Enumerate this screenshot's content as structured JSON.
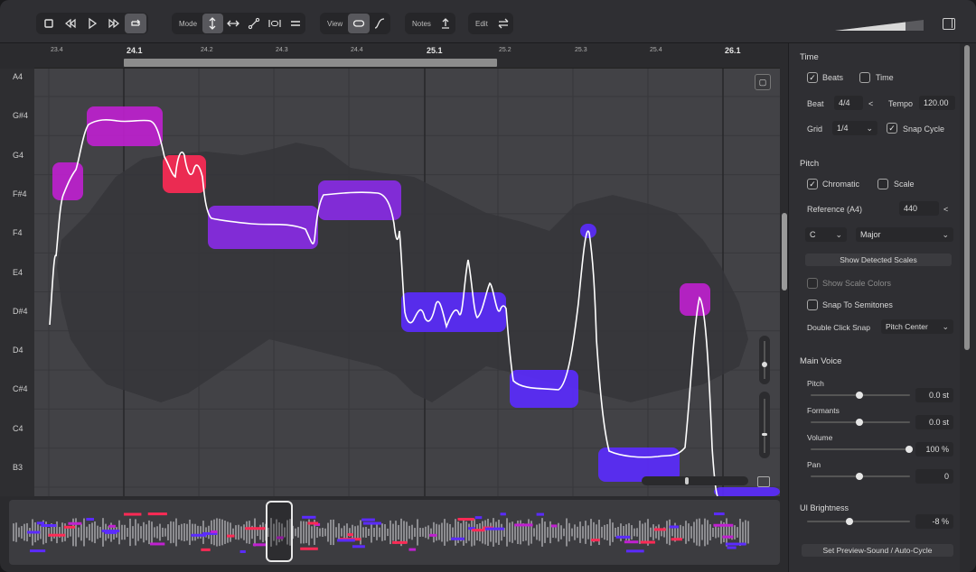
{
  "toolbar": {
    "mode_label": "Mode",
    "view_label": "View",
    "notes_label": "Notes",
    "edit_label": "Edit"
  },
  "ruler": {
    "ticks": [
      {
        "label": "23.4",
        "major": false
      },
      {
        "label": "24.1",
        "major": true
      },
      {
        "label": "24.2",
        "major": false
      },
      {
        "label": "24.3",
        "major": false
      },
      {
        "label": "24.4",
        "major": false
      },
      {
        "label": "25.1",
        "major": true
      },
      {
        "label": "25.2",
        "major": false
      },
      {
        "label": "25.3",
        "major": false
      },
      {
        "label": "25.4",
        "major": false
      },
      {
        "label": "26.1",
        "major": true
      }
    ]
  },
  "keys": [
    "A4",
    "G#4",
    "G4",
    "F#4",
    "F4",
    "E4",
    "D#4",
    "D4",
    "C#4",
    "C4",
    "B3"
  ],
  "panel": {
    "time": {
      "title": "Time",
      "beats_label": "Beats",
      "time_label": "Time",
      "beat_label": "Beat",
      "beat_value": "4/4",
      "beat_arrow": "<",
      "tempo_label": "Tempo",
      "tempo_value": "120.00",
      "grid_label": "Grid",
      "grid_value": "1/4",
      "snap_cycle_label": "Snap Cycle"
    },
    "pitch": {
      "title": "Pitch",
      "chromatic_label": "Chromatic",
      "scale_label": "Scale",
      "reference_label": "Reference (A4)",
      "reference_value": "440",
      "reference_arrow": "<",
      "key_value": "C",
      "scale_value": "Major",
      "show_detected_label": "Show Detected Scales",
      "show_scale_colors_label": "Show Scale Colors",
      "snap_semitones_label": "Snap To Semitones",
      "double_click_label": "Double Click Snap",
      "double_click_value": "Pitch Center"
    },
    "main_voice": {
      "title": "Main Voice",
      "pitch_label": "Pitch",
      "pitch_value": "0.0 st",
      "formants_label": "Formants",
      "formants_value": "0.0 st",
      "volume_label": "Volume",
      "volume_value": "100 %",
      "pan_label": "Pan",
      "pan_value": "0"
    },
    "ui_brightness": {
      "title": "UI Brightness",
      "value": "-8 %"
    },
    "preview_button": "Set Preview-Sound / Auto-Cycle"
  },
  "colors": {
    "note_purple": "#8a2be8",
    "note_blue": "#5b2bff",
    "note_magenta": "#c020d0",
    "note_red": "#ff2a55",
    "pitch_curve": "#ffffff"
  }
}
